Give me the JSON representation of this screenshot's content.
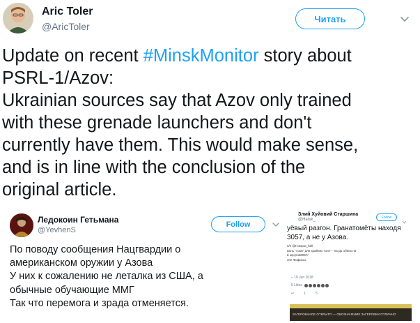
{
  "tweet": {
    "display_name": "Aric Toler",
    "handle": "@AricToler",
    "follow_label": "Читать",
    "text_before": "Update on recent ",
    "hashtag": "#MinskMonitor",
    "text_after": " story about\nPSRL-1/Azov:\nUkrainian sources say that Azov only trained\nwith these grenade launchers and don't\ncurrently have them. This would make sense,\nand is in line with the conclusion of the\noriginal article."
  },
  "quoted_1": {
    "display_name": "Ледокоин Гетьмана",
    "handle": "@YevhenS",
    "follow_label": "Follow",
    "text": "По поводу сообщения Нацгвардии о\nамериканском оружии у Азова\nУ них к сожалению не леталка из США, а\nобычные обучающие ММГ\nТак что перемога и зрада отменяется."
  },
  "quoted_2": {
    "display_name": "Злий Хуйовий Старшина",
    "handle": "@Hatsk_",
    "follow_label": "Follow",
    "text": "уёвый разгон. Гранатомёты находя\n3057, а не у Азова.",
    "embed_text": "n/n @Hotspot_hell\nиаль \"Азов\" для крайних толп\" - на До обеих на\nй округов8057/\nоне Фофиськ",
    "meta_line": "– 10 Jun 2018",
    "likes_label": "5 Likes",
    "action_counts": [
      "1",
      "5"
    ],
    "image_caption": "ЗАГЕРОВАНОЕ ОТКРЫТО — ОБОЗНАЧЕНИЕ ЗАГЕРОВКИ ОТЛИЧНО"
  },
  "colors": {
    "accent": "#1da1f2",
    "text": "#14171a",
    "muted": "#657786"
  },
  "icons": {
    "caret": "chevron-down-icon",
    "avatar": "avatar"
  }
}
